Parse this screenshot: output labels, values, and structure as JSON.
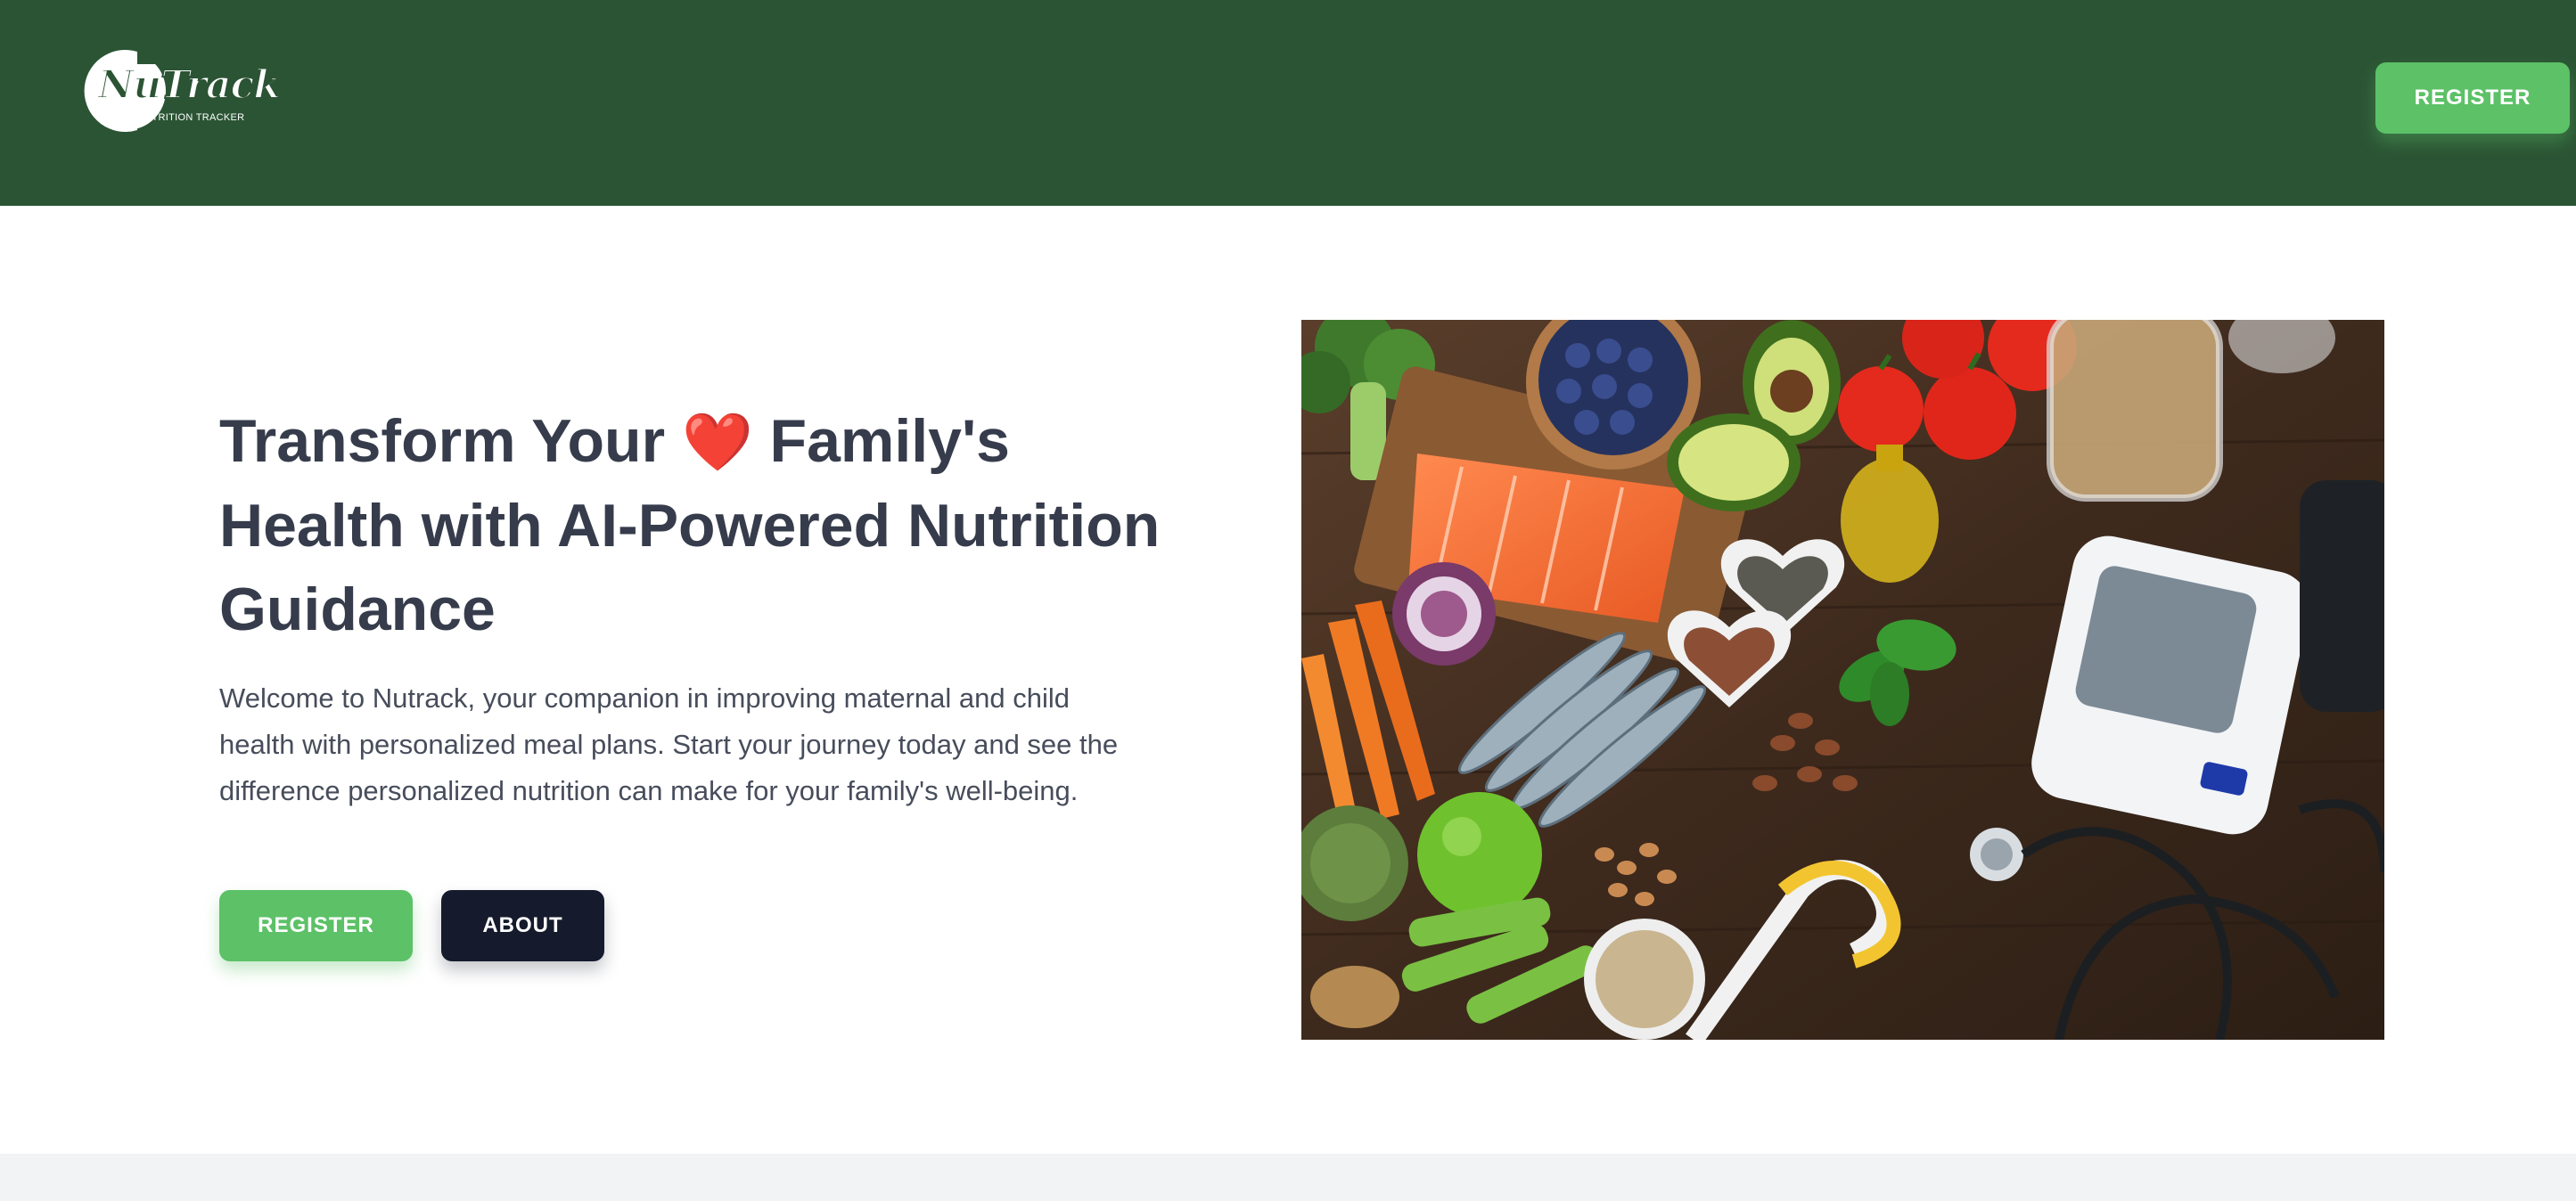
{
  "brand": {
    "logo_name": "NuTrack",
    "logo_name_part1": "Nu",
    "logo_name_part2": "Track",
    "logo_tagline": "NUTRITION TRACKER",
    "header_color": "#2b5434"
  },
  "header": {
    "register_label": "REGISTER"
  },
  "hero": {
    "title_part1": "Transform Your",
    "title_emoji": "❤️",
    "title_part2": "Family's Health with AI-Powered Nutrition Guidance",
    "description": "Welcome to Nutrack, your companion in improving maternal and child health with personalized meal plans. Start your journey today and see the difference personalized nutrition can make for your family's well-being.",
    "register_label": "REGISTER",
    "about_label": "ABOUT",
    "image_icon": "healthy-food-with-blood-pressure-monitor-photo"
  },
  "colors": {
    "accent_green": "#5cc167",
    "dark_button": "#151b2c",
    "heading_text": "#363c4b",
    "body_text": "#474d5b"
  }
}
